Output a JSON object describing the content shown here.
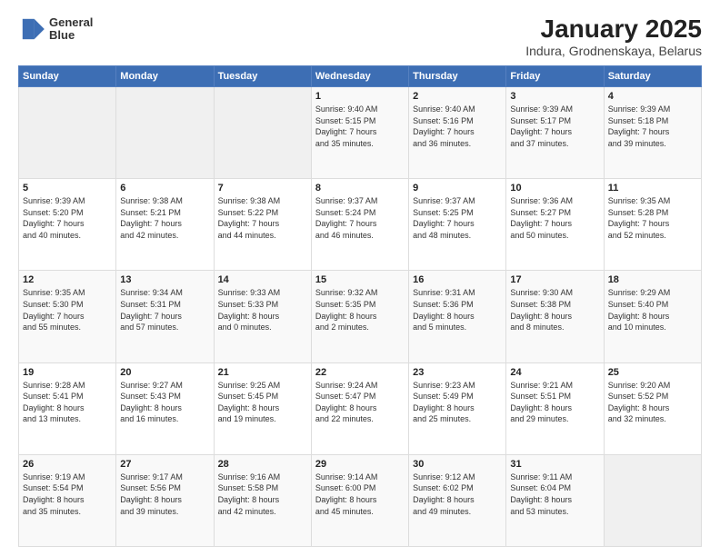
{
  "header": {
    "logo_line1": "General",
    "logo_line2": "Blue",
    "title": "January 2025",
    "subtitle": "Indura, Grodnenskaya, Belarus"
  },
  "days_of_week": [
    "Sunday",
    "Monday",
    "Tuesday",
    "Wednesday",
    "Thursday",
    "Friday",
    "Saturday"
  ],
  "weeks": [
    [
      {
        "day": "",
        "info": ""
      },
      {
        "day": "",
        "info": ""
      },
      {
        "day": "",
        "info": ""
      },
      {
        "day": "1",
        "info": "Sunrise: 9:40 AM\nSunset: 5:15 PM\nDaylight: 7 hours\nand 35 minutes."
      },
      {
        "day": "2",
        "info": "Sunrise: 9:40 AM\nSunset: 5:16 PM\nDaylight: 7 hours\nand 36 minutes."
      },
      {
        "day": "3",
        "info": "Sunrise: 9:39 AM\nSunset: 5:17 PM\nDaylight: 7 hours\nand 37 minutes."
      },
      {
        "day": "4",
        "info": "Sunrise: 9:39 AM\nSunset: 5:18 PM\nDaylight: 7 hours\nand 39 minutes."
      }
    ],
    [
      {
        "day": "5",
        "info": "Sunrise: 9:39 AM\nSunset: 5:20 PM\nDaylight: 7 hours\nand 40 minutes."
      },
      {
        "day": "6",
        "info": "Sunrise: 9:38 AM\nSunset: 5:21 PM\nDaylight: 7 hours\nand 42 minutes."
      },
      {
        "day": "7",
        "info": "Sunrise: 9:38 AM\nSunset: 5:22 PM\nDaylight: 7 hours\nand 44 minutes."
      },
      {
        "day": "8",
        "info": "Sunrise: 9:37 AM\nSunset: 5:24 PM\nDaylight: 7 hours\nand 46 minutes."
      },
      {
        "day": "9",
        "info": "Sunrise: 9:37 AM\nSunset: 5:25 PM\nDaylight: 7 hours\nand 48 minutes."
      },
      {
        "day": "10",
        "info": "Sunrise: 9:36 AM\nSunset: 5:27 PM\nDaylight: 7 hours\nand 50 minutes."
      },
      {
        "day": "11",
        "info": "Sunrise: 9:35 AM\nSunset: 5:28 PM\nDaylight: 7 hours\nand 52 minutes."
      }
    ],
    [
      {
        "day": "12",
        "info": "Sunrise: 9:35 AM\nSunset: 5:30 PM\nDaylight: 7 hours\nand 55 minutes."
      },
      {
        "day": "13",
        "info": "Sunrise: 9:34 AM\nSunset: 5:31 PM\nDaylight: 7 hours\nand 57 minutes."
      },
      {
        "day": "14",
        "info": "Sunrise: 9:33 AM\nSunset: 5:33 PM\nDaylight: 8 hours\nand 0 minutes."
      },
      {
        "day": "15",
        "info": "Sunrise: 9:32 AM\nSunset: 5:35 PM\nDaylight: 8 hours\nand 2 minutes."
      },
      {
        "day": "16",
        "info": "Sunrise: 9:31 AM\nSunset: 5:36 PM\nDaylight: 8 hours\nand 5 minutes."
      },
      {
        "day": "17",
        "info": "Sunrise: 9:30 AM\nSunset: 5:38 PM\nDaylight: 8 hours\nand 8 minutes."
      },
      {
        "day": "18",
        "info": "Sunrise: 9:29 AM\nSunset: 5:40 PM\nDaylight: 8 hours\nand 10 minutes."
      }
    ],
    [
      {
        "day": "19",
        "info": "Sunrise: 9:28 AM\nSunset: 5:41 PM\nDaylight: 8 hours\nand 13 minutes."
      },
      {
        "day": "20",
        "info": "Sunrise: 9:27 AM\nSunset: 5:43 PM\nDaylight: 8 hours\nand 16 minutes."
      },
      {
        "day": "21",
        "info": "Sunrise: 9:25 AM\nSunset: 5:45 PM\nDaylight: 8 hours\nand 19 minutes."
      },
      {
        "day": "22",
        "info": "Sunrise: 9:24 AM\nSunset: 5:47 PM\nDaylight: 8 hours\nand 22 minutes."
      },
      {
        "day": "23",
        "info": "Sunrise: 9:23 AM\nSunset: 5:49 PM\nDaylight: 8 hours\nand 25 minutes."
      },
      {
        "day": "24",
        "info": "Sunrise: 9:21 AM\nSunset: 5:51 PM\nDaylight: 8 hours\nand 29 minutes."
      },
      {
        "day": "25",
        "info": "Sunrise: 9:20 AM\nSunset: 5:52 PM\nDaylight: 8 hours\nand 32 minutes."
      }
    ],
    [
      {
        "day": "26",
        "info": "Sunrise: 9:19 AM\nSunset: 5:54 PM\nDaylight: 8 hours\nand 35 minutes."
      },
      {
        "day": "27",
        "info": "Sunrise: 9:17 AM\nSunset: 5:56 PM\nDaylight: 8 hours\nand 39 minutes."
      },
      {
        "day": "28",
        "info": "Sunrise: 9:16 AM\nSunset: 5:58 PM\nDaylight: 8 hours\nand 42 minutes."
      },
      {
        "day": "29",
        "info": "Sunrise: 9:14 AM\nSunset: 6:00 PM\nDaylight: 8 hours\nand 45 minutes."
      },
      {
        "day": "30",
        "info": "Sunrise: 9:12 AM\nSunset: 6:02 PM\nDaylight: 8 hours\nand 49 minutes."
      },
      {
        "day": "31",
        "info": "Sunrise: 9:11 AM\nSunset: 6:04 PM\nDaylight: 8 hours\nand 53 minutes."
      },
      {
        "day": "",
        "info": ""
      }
    ]
  ]
}
